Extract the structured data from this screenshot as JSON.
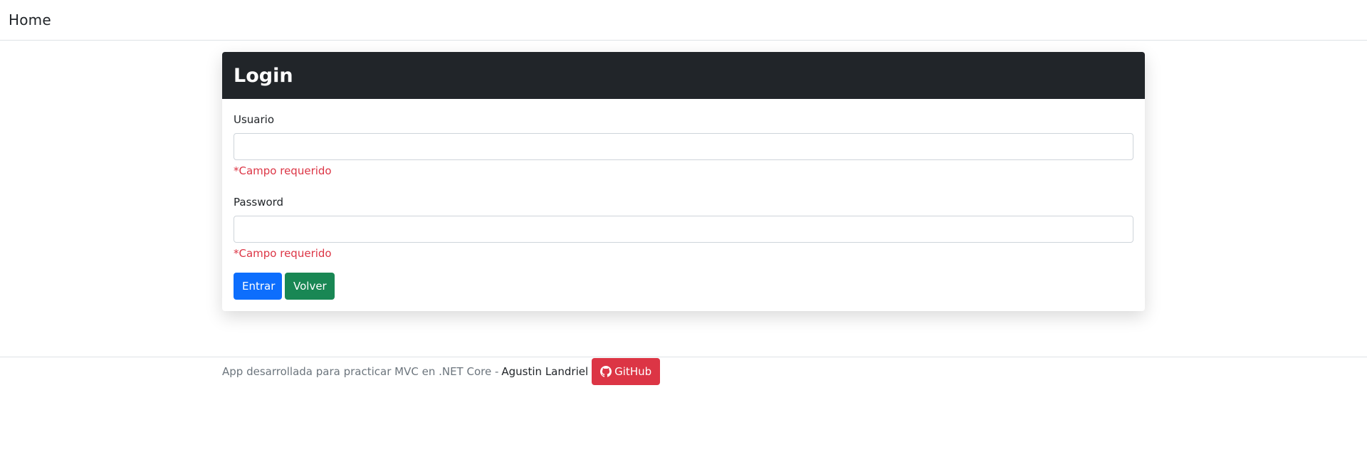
{
  "nav": {
    "brand": "Home"
  },
  "card": {
    "title": "Login",
    "fields": [
      {
        "label": "Usuario",
        "value": "",
        "error": "*Campo requerido"
      },
      {
        "label": "Password",
        "value": "",
        "error": "*Campo requerido"
      }
    ],
    "buttons": {
      "submit": "Entrar",
      "back": "Volver"
    }
  },
  "footer": {
    "text": "App desarrollada para practicar MVC en .NET Core -",
    "author": "Agustin Landriel",
    "github_label": "GitHub",
    "github_icon": "github-icon"
  },
  "colors": {
    "header_bg": "#212529",
    "primary": "#0d6efd",
    "success": "#198754",
    "danger": "#dc3545"
  }
}
